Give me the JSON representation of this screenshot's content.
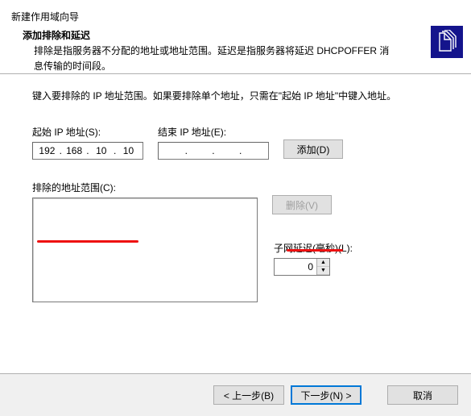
{
  "window": {
    "title": "新建作用域向导",
    "subtitle": "添加排除和延迟",
    "description": "排除是指服务器不分配的地址或地址范围。延迟是指服务器将延迟 DHCPOFFER 消息传输的时间段。"
  },
  "body": {
    "instruction": "键入要排除的 IP 地址范围。如果要排除单个地址，只需在\"起始 IP 地址\"中键入地址。",
    "start_ip_label": "起始 IP 地址(S):",
    "end_ip_label": "结束 IP 地址(E):",
    "start_ip": {
      "o1": "192",
      "o2": "168",
      "o3": "10",
      "o4": "10"
    },
    "end_ip": {
      "o1": "",
      "o2": "",
      "o3": "",
      "o4": ""
    },
    "add_btn": "添加(D)",
    "excluded_label": "排除的地址范围(C):",
    "remove_btn": "删除(V)",
    "delay_label": "子网延迟(毫秒)(L):",
    "delay_value": "0"
  },
  "footer": {
    "back": "< 上一步(B)",
    "next": "下一步(N) >",
    "cancel": "取消"
  }
}
